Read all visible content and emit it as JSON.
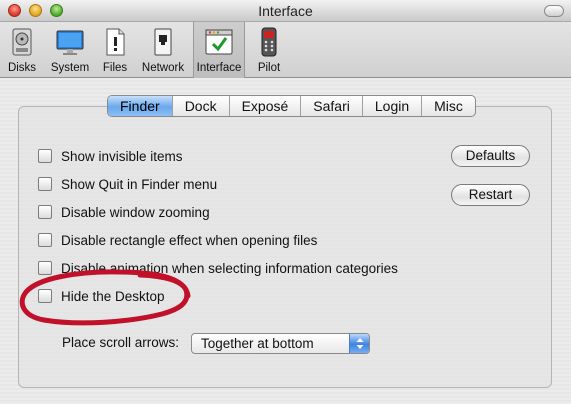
{
  "window": {
    "title": "Interface"
  },
  "toolbar": {
    "items": [
      {
        "label": "Disks",
        "icon": "disk-icon"
      },
      {
        "label": "System",
        "icon": "monitor-icon"
      },
      {
        "label": "Files",
        "icon": "file-icon"
      },
      {
        "label": "Network",
        "icon": "network-icon"
      },
      {
        "label": "Interface",
        "icon": "window-checkmark-icon",
        "selected": true
      },
      {
        "label": "Pilot",
        "icon": "remote-icon"
      }
    ]
  },
  "tabs": [
    {
      "label": "Finder",
      "active": true
    },
    {
      "label": "Dock"
    },
    {
      "label": "Exposé"
    },
    {
      "label": "Safari"
    },
    {
      "label": "Login"
    },
    {
      "label": "Misc"
    }
  ],
  "options": [
    {
      "label": "Show invisible items",
      "checked": false
    },
    {
      "label": "Show Quit in Finder menu",
      "checked": false
    },
    {
      "label": "Disable window zooming",
      "checked": false
    },
    {
      "label": "Disable rectangle effect when opening files",
      "checked": false
    },
    {
      "label": "Disable animation when selecting information categories",
      "checked": false
    },
    {
      "label": "Hide the Desktop",
      "checked": false
    }
  ],
  "buttons": {
    "defaults": "Defaults",
    "restart": "Restart"
  },
  "scroll_arrows": {
    "label": "Place scroll arrows:",
    "value": "Together at bottom"
  },
  "colors": {
    "annotation": "#c0102a",
    "tab_active": "#6aa8ec"
  }
}
